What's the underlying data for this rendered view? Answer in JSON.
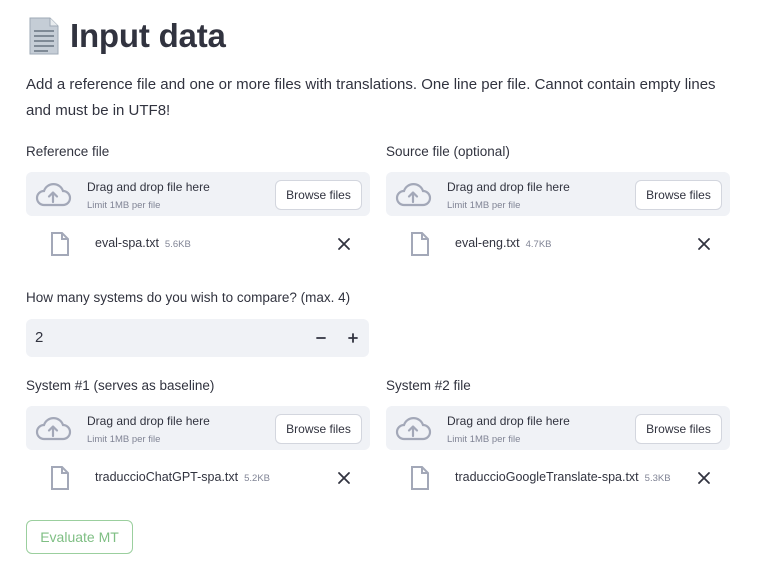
{
  "page": {
    "title": "Input data",
    "title_icon": "page-facing-up-icon",
    "description": "Add a reference file and one or more files with translations. One line per file. Cannot contain empty lines and must be in UTF8!"
  },
  "uploaders": [
    {
      "label": "Reference file",
      "dropzone_text": "Drag and drop file here",
      "limit_text": "Limit 1MB per file",
      "browse_label": "Browse files",
      "file": {
        "name": "eval-spa.txt",
        "size": "5.6KB"
      }
    },
    {
      "label": "Source file (optional)",
      "dropzone_text": "Drag and drop file here",
      "limit_text": "Limit 1MB per file",
      "browse_label": "Browse files",
      "file": {
        "name": "eval-eng.txt",
        "size": "4.7KB"
      }
    },
    {
      "label": "System #1 (serves as baseline)",
      "dropzone_text": "Drag and drop file here",
      "limit_text": "Limit 1MB per file",
      "browse_label": "Browse files",
      "file": {
        "name": "traduccioChatGPT-spa.txt",
        "size": "5.2KB"
      }
    },
    {
      "label": "System #2 file",
      "dropzone_text": "Drag and drop file here",
      "limit_text": "Limit 1MB per file",
      "browse_label": "Browse files",
      "file": {
        "name": "traduccioGoogleTranslate-spa.txt",
        "size": "5.3KB"
      }
    }
  ],
  "systems_input": {
    "label": "How many systems do you wish to compare? (max. 4)",
    "value": "2",
    "minus_symbol": "−",
    "plus_symbol": "+"
  },
  "evaluate_button": {
    "label": "Evaluate MT"
  },
  "colors": {
    "text": "#31333F",
    "muted": "#808495",
    "dropzone_bg": "#F0F2F6",
    "button_border": "#D3D6DE",
    "evaluate_accent": "#7FBF84",
    "icon": "#A3A8B8"
  }
}
